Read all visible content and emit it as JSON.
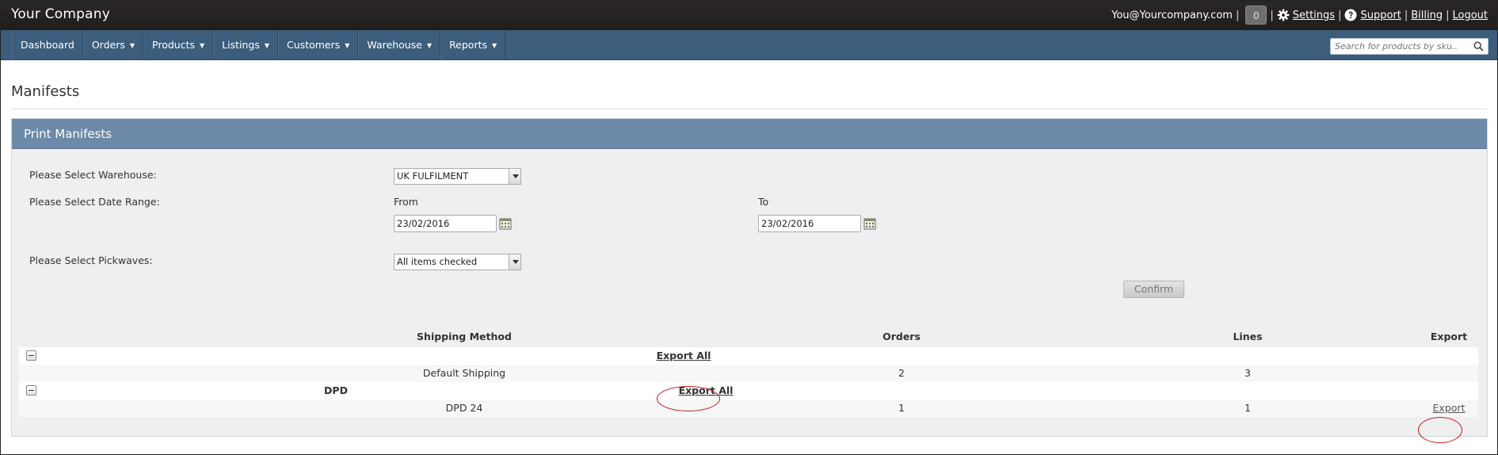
{
  "app": {
    "brand": "Your Company",
    "user_email": "You@Yourcompany.com",
    "notification_count": "0",
    "settings_label": "Settings",
    "support_label": "Support",
    "billing_label": "Billing",
    "logout_label": "Logout",
    "separator": "|"
  },
  "nav": {
    "items": [
      {
        "label": "Dashboard",
        "has_menu": false
      },
      {
        "label": "Orders",
        "has_menu": true
      },
      {
        "label": "Products",
        "has_menu": true
      },
      {
        "label": "Listings",
        "has_menu": true
      },
      {
        "label": "Customers",
        "has_menu": true
      },
      {
        "label": "Warehouse",
        "has_menu": true
      },
      {
        "label": "Reports",
        "has_menu": true
      }
    ],
    "caret": "▼",
    "search_placeholder": "Search for products by sku.."
  },
  "page": {
    "title": "Manifests"
  },
  "panel": {
    "title": "Print Manifests",
    "warehouse_label": "Please Select Warehouse:",
    "warehouse_value": "UK FULFILMENT",
    "date_range_label": "Please Select Date Range:",
    "from_label": "From",
    "from_value": "23/02/2016",
    "to_label": "To",
    "to_value": "23/02/2016",
    "pickwaves_label": "Please Select Pickwaves:",
    "pickwaves_value": "All items checked",
    "confirm_label": "Confirm"
  },
  "grid": {
    "columns": [
      "Shipping Method",
      "Orders",
      "Lines",
      "Export"
    ],
    "groups": [
      {
        "name": "",
        "export_all_label": "Export All",
        "rows": [
          {
            "method": "Default Shipping",
            "orders": "2",
            "lines": "3",
            "export": ""
          }
        ]
      },
      {
        "name": "DPD",
        "export_all_label": "Export All",
        "rows": [
          {
            "method": "DPD 24",
            "orders": "1",
            "lines": "1",
            "export": "Export"
          }
        ]
      }
    ]
  },
  "colors": {
    "topbar": "#221f1e",
    "navbar": "#3c5d7c",
    "panel_header": "#6d8aa8",
    "highlight_ring": "#c4181e"
  }
}
